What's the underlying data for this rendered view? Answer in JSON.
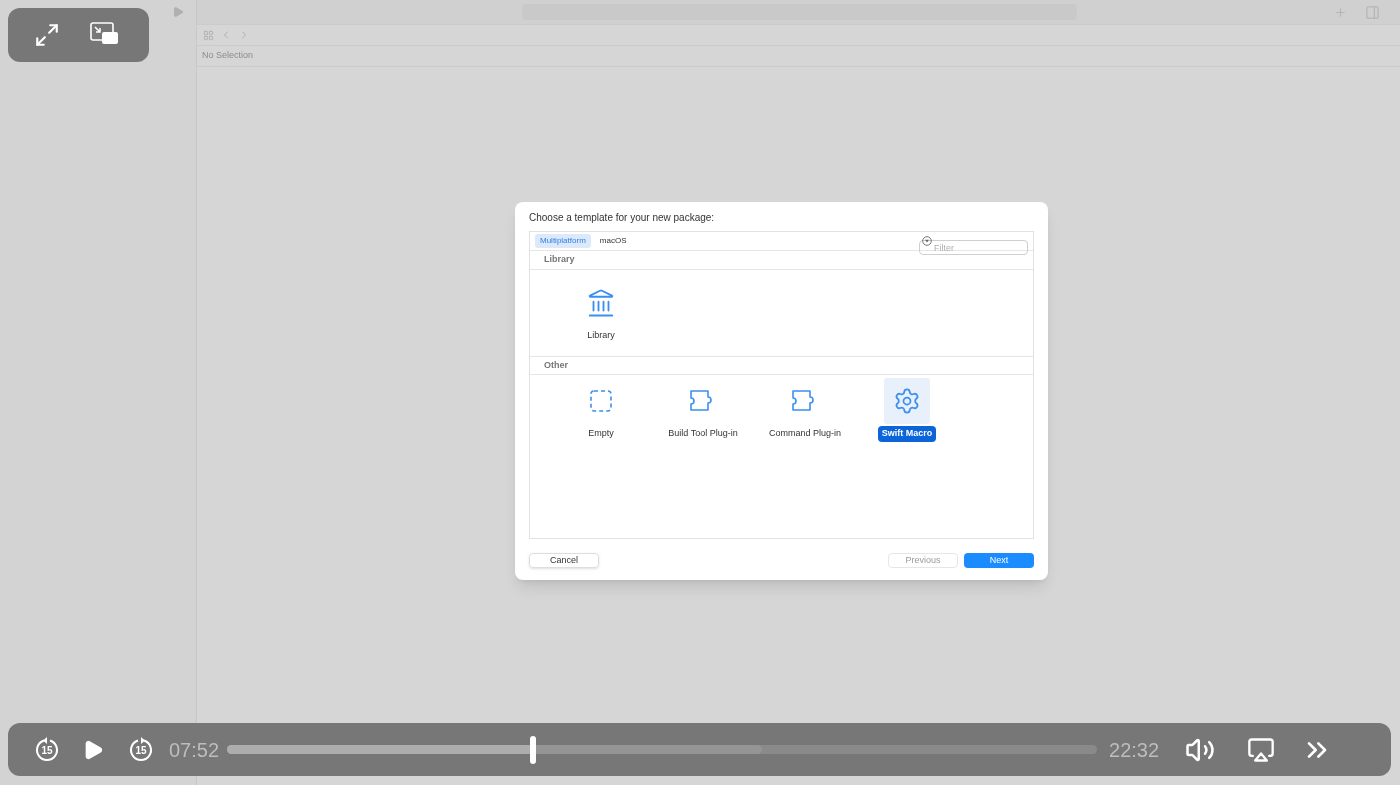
{
  "xcode": {
    "editor_title": "No Selection"
  },
  "dialog": {
    "title": "Choose a template for your new package:",
    "platform_tabs": [
      {
        "label": "Multiplatform",
        "selected": true
      },
      {
        "label": "macOS",
        "selected": false
      }
    ],
    "filter": {
      "placeholder": "Filter"
    },
    "sections": [
      {
        "title": "Library",
        "templates": [
          {
            "label": "Library",
            "kind": "library",
            "selected": false
          }
        ]
      },
      {
        "title": "Other",
        "templates": [
          {
            "label": "Empty",
            "kind": "empty",
            "selected": false
          },
          {
            "label": "Build Tool Plug-in",
            "kind": "plugin",
            "selected": false
          },
          {
            "label": "Command Plug-in",
            "kind": "plugin",
            "selected": false
          },
          {
            "label": "Swift Macro",
            "kind": "macro",
            "selected": true
          }
        ]
      }
    ],
    "buttons": [
      {
        "label": "Cancel",
        "kind": "cancel",
        "disabled": false
      },
      {
        "label": "Previous",
        "kind": "previous",
        "disabled": true
      },
      {
        "label": "Next",
        "kind": "next",
        "disabled": false
      }
    ]
  },
  "video_player": {
    "playing": false,
    "skip_back_label": "15",
    "skip_forward_label": "15",
    "elapsed": "07:52",
    "remaining": "22:32",
    "level": 0.352
  }
}
